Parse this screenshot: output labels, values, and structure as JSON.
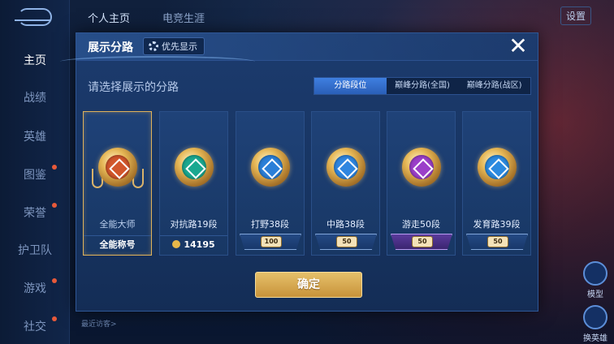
{
  "sidebar": {
    "items": [
      {
        "label": "主页",
        "active": true
      },
      {
        "label": "战绩"
      },
      {
        "label": "英雄"
      },
      {
        "label": "图鉴",
        "dot": true
      },
      {
        "label": "荣誉",
        "dot": true
      },
      {
        "label": "护卫队"
      },
      {
        "label": "游戏",
        "dot": true
      },
      {
        "label": "社交",
        "dot": true
      }
    ]
  },
  "topbar": {
    "tabs": [
      "个人主页",
      "电竞生涯"
    ],
    "settings_label": "设置"
  },
  "right_actions": [
    "模型",
    "换英雄"
  ],
  "bottom": {
    "recent_visitors": "最近访客>"
  },
  "modal": {
    "title": "展示分路",
    "priority_label": "优先显示",
    "close_icon": "close-icon",
    "subtitle": "请选择展示的分路",
    "tabs": [
      {
        "label": "分路段位",
        "active": true
      },
      {
        "label": "巅峰分路(全国)"
      },
      {
        "label": "巅峰分路(战区)"
      }
    ],
    "cards": [
      {
        "label": "全能大师",
        "footer": "全能称号",
        "selected": true,
        "core_color": "#d2562b"
      },
      {
        "label": "对抗路19段",
        "footer": "14195",
        "coin": true,
        "core_color": "#1aa890"
      },
      {
        "label": "打野38段",
        "rank": "100",
        "core_color": "#2a7fd8"
      },
      {
        "label": "中路38段",
        "rank": "50",
        "core_color": "#2f86e0"
      },
      {
        "label": "游走50段",
        "rank": "50",
        "purple": true,
        "core_color": "#9b3fc9"
      },
      {
        "label": "发育路39段",
        "rank": "50",
        "core_color": "#2c8ae0"
      }
    ],
    "confirm_label": "确定"
  },
  "colors": {
    "accent_gold": "#e0b25a",
    "tab_active": "#3f7fe0",
    "modal_bg": "#1c3b6e"
  }
}
